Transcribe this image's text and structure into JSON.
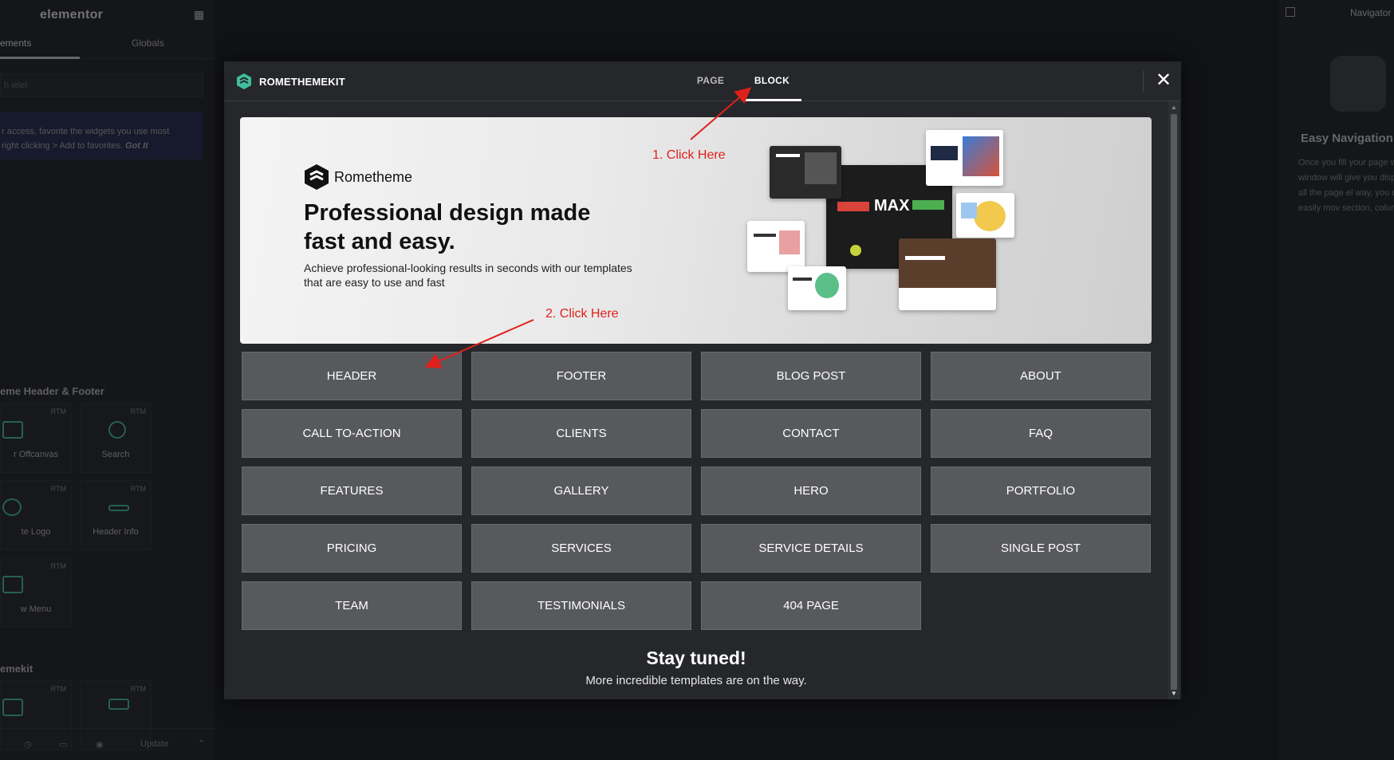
{
  "left_panel": {
    "logo": "elementor",
    "tabs": [
      "ements",
      "Globals"
    ],
    "search_placeholder": "h ielet",
    "notice_line1": "r access, favorite the widgets you use most",
    "notice_line2": "right clicking > Add to favorites.",
    "notice_link": "Got It",
    "section1": "eme Header & Footer",
    "section2": "emekit",
    "badge": "RTM",
    "widgets": [
      "r Offcanvas",
      "Search",
      "te Logo",
      "Header Info",
      "w Menu"
    ],
    "footer_update": "Update"
  },
  "navigator": {
    "title": "Navigator",
    "empty_title": "Easy Navigation",
    "empty_text": "Once you fill your page w this window will give you display of all the page el way, you can easily mov section, column, or"
  },
  "modal": {
    "brand": "ROMETHEMEKIT",
    "tabs": [
      {
        "label": "PAGE",
        "active": false
      },
      {
        "label": "BLOCK",
        "active": true
      }
    ],
    "close_glyph": "✕",
    "banner": {
      "logo_text": "Rometheme",
      "title_line1": "Professional design made",
      "title_line2": "fast and easy.",
      "subtitle_line1": "Achieve professional-looking results in seconds with our templates",
      "subtitle_line2": "that are easy to use and fast",
      "mock_text": "MAX"
    },
    "categories": [
      "HEADER",
      "FOOTER",
      "BLOG POST",
      "ABOUT",
      "CALL TO-ACTION",
      "CLIENTS",
      "CONTACT",
      "FAQ",
      "FEATURES",
      "GALLERY",
      "HERO",
      "PORTFOLIO",
      "PRICING",
      "SERVICES",
      "SERVICE DETAILS",
      "SINGLE POST",
      "TEAM",
      "TESTIMONIALS",
      "404 PAGE"
    ],
    "stay_title": "Stay tuned!",
    "stay_text": "More incredible templates are on the way."
  },
  "annotations": {
    "step1": "1. Click Here",
    "step2": "2. Click Here",
    "color": "#e0201c"
  },
  "colors": {
    "accent": "#3fbf9f",
    "modal_bg": "#26272b",
    "button_bg": "#58595c"
  }
}
